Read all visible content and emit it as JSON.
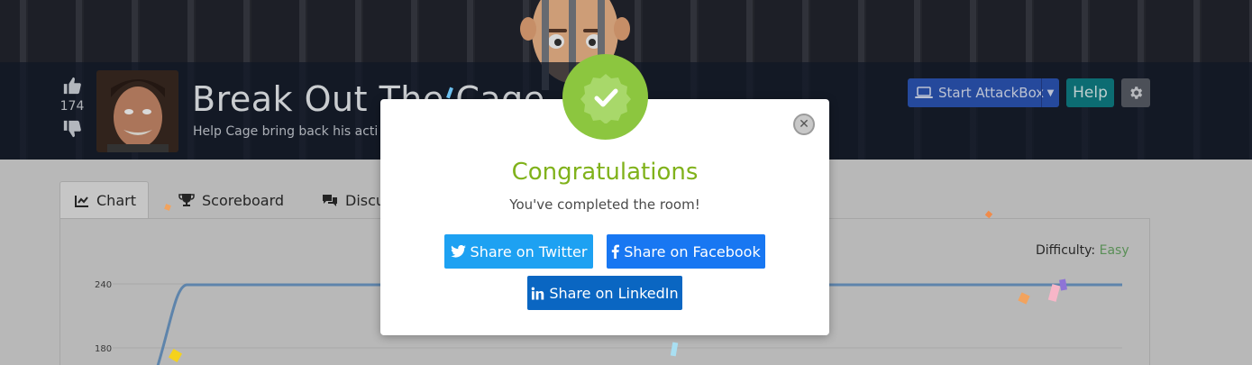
{
  "room": {
    "votes": "174",
    "title": "Break Out The Cage",
    "subtitle": "Help Cage bring back his acti"
  },
  "toolbar": {
    "attackbox_label": "Start AttackBox",
    "help_label": "Help"
  },
  "tabs": [
    {
      "label": "Chart",
      "icon": "chart-line-icon",
      "active": true
    },
    {
      "label": "Scoreboard",
      "icon": "trophy-icon",
      "active": false
    },
    {
      "label": "Discu",
      "icon": "comments-icon",
      "active": false
    }
  ],
  "difficulty": {
    "label": "Difficulty:",
    "value": "Easy"
  },
  "chart_data": {
    "type": "line",
    "y_ticks": [
      "240",
      "180"
    ],
    "series": [
      {
        "values_note": "",
        "color": "#6f9cc9"
      }
    ]
  },
  "modal": {
    "title": "Congratulations",
    "message": "You've completed the room!",
    "share_twitter": "Share on Twitter",
    "share_facebook": "Share on Facebook",
    "share_linkedin": "Share on LinkedIn"
  },
  "colors": {
    "success_green": "#8cc63f",
    "twitter": "#1da1f2",
    "facebook": "#1877f2",
    "linkedin": "#0a66c2",
    "attackbox_blue": "#2c56b8",
    "help_teal": "#0f7f86"
  }
}
